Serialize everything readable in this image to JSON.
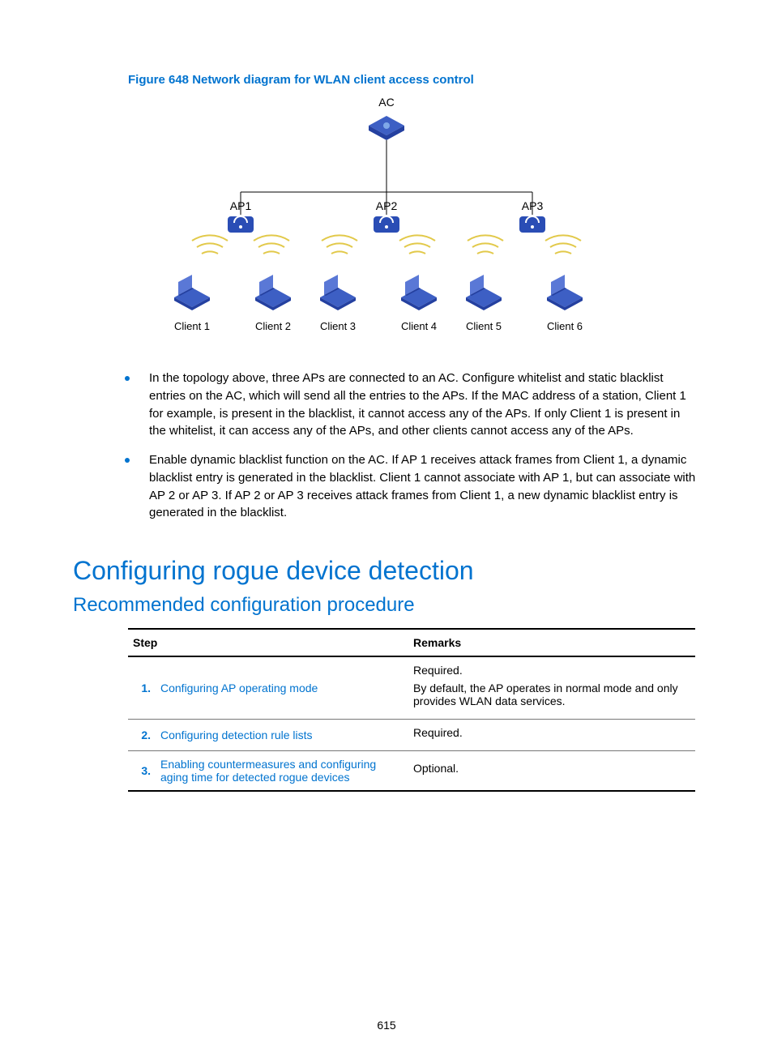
{
  "figure": {
    "caption": "Figure 648 Network diagram for WLAN client access control",
    "labels": {
      "ac": "AC",
      "ap1": "AP1",
      "ap2": "AP2",
      "ap3": "AP3",
      "c1": "Client 1",
      "c2": "Client 2",
      "c3": "Client 3",
      "c4": "Client 4",
      "c5": "Client 5",
      "c6": "Client 6"
    }
  },
  "bullets": [
    "In the topology above, three APs are connected to an AC. Configure whitelist and static blacklist entries on the AC, which will send all the entries to the APs. If the MAC address of a station, Client 1 for example, is present in the blacklist, it cannot access any of the APs. If only Client 1 is present in the whitelist, it can access any of the APs, and other clients cannot access any of the APs.",
    "Enable dynamic blacklist function on the AC. If AP 1 receives attack frames from Client 1, a dynamic blacklist entry is generated in the blacklist. Client 1 cannot associate with AP 1, but can associate with AP 2 or AP 3. If AP 2 or AP 3 receives attack frames from Client 1, a new dynamic blacklist entry is generated in the blacklist."
  ],
  "h1": "Configuring rogue device detection",
  "h2": "Recommended configuration procedure",
  "table": {
    "head": {
      "step": "Step",
      "remarks": "Remarks"
    },
    "rows": [
      {
        "n": "1.",
        "step": "Configuring AP operating mode",
        "remarks1": "Required.",
        "remarks2": "By default, the AP operates in normal mode and only provides WLAN data services."
      },
      {
        "n": "2.",
        "step": "Configuring detection rule lists",
        "remarks1": "Required."
      },
      {
        "n": "3.",
        "step": "Enabling countermeasures and configuring aging time for detected rogue devices",
        "remarks1": "Optional."
      }
    ]
  },
  "pagenum": "615"
}
